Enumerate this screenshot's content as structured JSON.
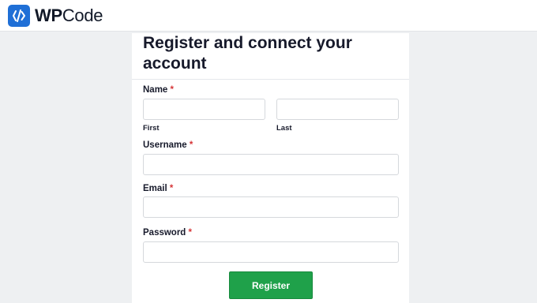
{
  "header": {
    "brand_bold": "WP",
    "brand_rest": "Code",
    "logo_icon": "wpcode-logo-icon",
    "logo_color": "#1f6fd6"
  },
  "form": {
    "title": "Register and connect your account",
    "required_mark": "*",
    "name": {
      "label": "Name",
      "first_sublabel": "First",
      "last_sublabel": "Last",
      "first_value": "",
      "last_value": ""
    },
    "username": {
      "label": "Username",
      "value": ""
    },
    "email": {
      "label": "Email",
      "value": ""
    },
    "password": {
      "label": "Password",
      "value": ""
    },
    "submit_label": "Register",
    "submit_color": "#1fa14a",
    "required_color": "#d63638"
  }
}
